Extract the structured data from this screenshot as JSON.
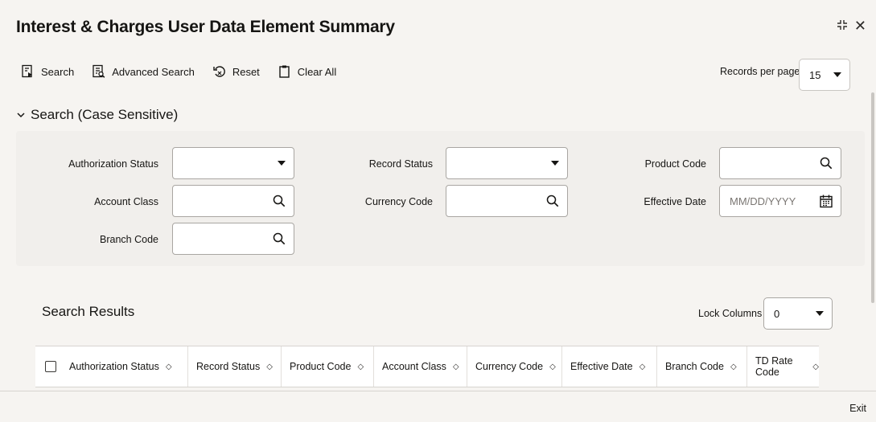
{
  "window": {
    "title": "Interest & Charges User Data Element Summary"
  },
  "toolbar": {
    "search": "Search",
    "advanced_search": "Advanced Search",
    "reset": "Reset",
    "clear_all": "Clear All"
  },
  "records_per_page": {
    "label": "Records per page",
    "value": "15"
  },
  "search_section": {
    "title": "Search (Case Sensitive)"
  },
  "fields": {
    "authorization_status": {
      "label": "Authorization Status",
      "value": ""
    },
    "record_status": {
      "label": "Record Status",
      "value": ""
    },
    "product_code": {
      "label": "Product Code",
      "value": ""
    },
    "account_class": {
      "label": "Account Class",
      "value": ""
    },
    "currency_code": {
      "label": "Currency Code",
      "value": ""
    },
    "effective_date": {
      "label": "Effective Date",
      "placeholder": "MM/DD/YYYY"
    },
    "branch_code": {
      "label": "Branch Code",
      "value": ""
    }
  },
  "results": {
    "title": "Search Results",
    "lock_columns_label": "Lock Columns",
    "lock_columns_value": "0",
    "columns": [
      "Authorization Status",
      "Record Status",
      "Product Code",
      "Account Class",
      "Currency Code",
      "Effective Date",
      "Branch Code",
      "TD Rate Code"
    ]
  },
  "footer": {
    "exit": "Exit"
  }
}
